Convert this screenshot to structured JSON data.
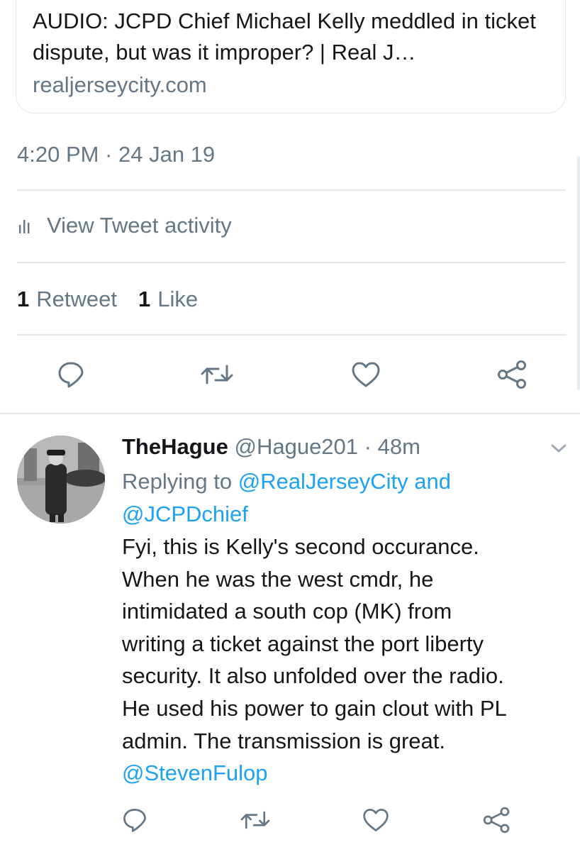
{
  "link_card": {
    "title": "AUDIO: JCPD Chief Michael Kelly meddled in ticket dispute, but was it improper? | Real J…",
    "domain": "realjerseycity.com"
  },
  "tweet": {
    "timestamp": "4:20 PM · 24 Jan 19",
    "activity_label": "View Tweet activity",
    "retweet_count": "1",
    "retweet_label": "Retweet",
    "like_count": "1",
    "like_label": "Like"
  },
  "reply": {
    "author_name": "TheHague",
    "author_handle": "@Hague201",
    "separator": "·",
    "time_ago": "48m",
    "replying_prefix": "Replying to",
    "replying_to_1": "@RealJerseyCity",
    "replying_and": "and",
    "replying_to_2": "@JCPDchief",
    "body": "Fyi, this is Kelly's second occurance.\nWhen he was the west cmdr, he\nintimidated a south cop (MK) from\nwriting a ticket against the port liberty\nsecurity. It also unfolded over the radio.\nHe used his power to gain clout with PL\nadmin. The transmission is great.",
    "body_mention": "@StevenFulop"
  },
  "icons": {
    "reply": "reply-icon",
    "retweet": "retweet-icon",
    "like": "heart-icon",
    "share": "share-icon",
    "activity": "bar-chart-icon",
    "caret": "chevron-down-icon"
  },
  "colors": {
    "text": "#14171a",
    "secondary": "#657786",
    "accent": "#1da1f2",
    "divider": "#e1e8ed"
  }
}
